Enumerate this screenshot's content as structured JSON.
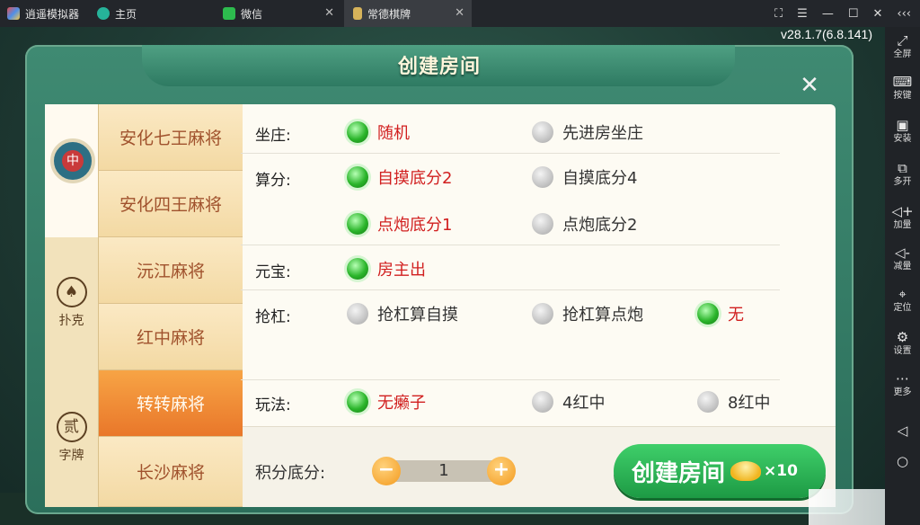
{
  "emulator": {
    "app_name": "逍遥模拟器",
    "tabs": [
      {
        "label": "主页",
        "icon": "home-icon"
      },
      {
        "label": "微信",
        "icon": "wechat-icon"
      },
      {
        "label": "常德棋牌",
        "icon": "game-icon"
      }
    ],
    "side_panel": [
      {
        "label": "全屏",
        "glyph": "⤢"
      },
      {
        "label": "按键",
        "glyph": "⌨"
      },
      {
        "label": "安装",
        "glyph": "▣"
      },
      {
        "label": "多开",
        "glyph": "⧉"
      },
      {
        "label": "加量",
        "glyph": "◁+"
      },
      {
        "label": "减量",
        "glyph": "◁-"
      },
      {
        "label": "定位",
        "glyph": "⌖"
      },
      {
        "label": "设置",
        "glyph": "⚙"
      },
      {
        "label": "更多",
        "glyph": "⋯"
      }
    ]
  },
  "game": {
    "version": "v28.1.7(6.8.141)"
  },
  "dialog": {
    "title": "创建房间",
    "close_glyph": "✕",
    "categories": [
      {
        "label": "",
        "glyph": "中",
        "active": true
      },
      {
        "label": "扑克",
        "glyph": "♠",
        "active": false
      },
      {
        "label": "字牌",
        "glyph": "贰",
        "active": false
      }
    ],
    "games": [
      "安化七王麻将",
      "安化四王麻将",
      "沅江麻将",
      "红中麻将",
      "转转麻将",
      "长沙麻将"
    ],
    "selected_game": "转转麻将",
    "rules": {
      "zuozhuang": {
        "label": "坐庄:",
        "options": [
          {
            "text": "随机",
            "selected": true
          },
          {
            "text": "先进房坐庄",
            "selected": false
          }
        ]
      },
      "suanfen": {
        "label": "算分:",
        "options": [
          {
            "text": "自摸底分2",
            "selected": true
          },
          {
            "text": "自摸底分4",
            "selected": false
          },
          {
            "text": "点炮底分1",
            "selected": true
          },
          {
            "text": "点炮底分2",
            "selected": false
          }
        ]
      },
      "yuanbao": {
        "label": "元宝:",
        "options": [
          {
            "text": "房主出",
            "selected": true
          }
        ]
      },
      "qianggang": {
        "label": "抢杠:",
        "options": [
          {
            "text": "抢杠算自摸",
            "selected": false
          },
          {
            "text": "抢杠算点炮",
            "selected": false
          },
          {
            "text": "无",
            "selected": true
          }
        ]
      },
      "wanfa": {
        "label": "玩法:",
        "options": [
          {
            "text": "无癞子",
            "selected": true
          },
          {
            "text": "4红中",
            "selected": false
          },
          {
            "text": "8红中",
            "selected": false
          }
        ]
      }
    },
    "score_label": "积分底分:",
    "score_value": "1",
    "minus_glyph": "−",
    "plus_glyph": "+",
    "create_button": "创建房间",
    "create_cost": "×10"
  }
}
